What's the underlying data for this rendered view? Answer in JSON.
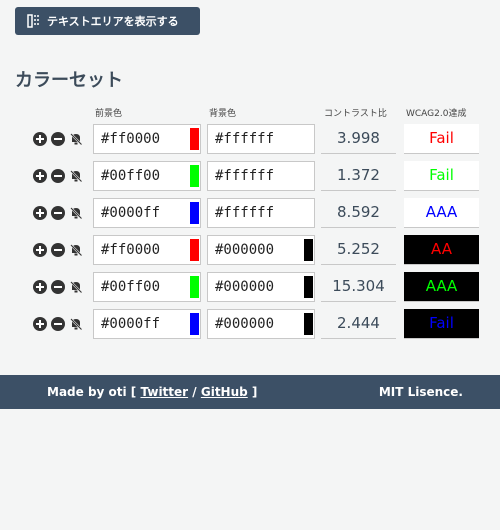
{
  "toolbar": {
    "toggle_label": "テキストエリアを表示する"
  },
  "section": {
    "title": "カラーセット"
  },
  "columns": {
    "foreground": "前景色",
    "background": "背景色",
    "contrast": "コントラスト比",
    "wcag": "WCAG2.0達成"
  },
  "rows": [
    {
      "fg": "#ff0000",
      "bg": "#ffffff",
      "ratio": "3.998",
      "grade": "Fail"
    },
    {
      "fg": "#00ff00",
      "bg": "#ffffff",
      "ratio": "1.372",
      "grade": "Fail"
    },
    {
      "fg": "#0000ff",
      "bg": "#ffffff",
      "ratio": "8.592",
      "grade": "AAA"
    },
    {
      "fg": "#ff0000",
      "bg": "#000000",
      "ratio": "5.252",
      "grade": "AA"
    },
    {
      "fg": "#00ff00",
      "bg": "#000000",
      "ratio": "15.304",
      "grade": "AAA"
    },
    {
      "fg": "#0000ff",
      "bg": "#000000",
      "ratio": "2.444",
      "grade": "Fail"
    }
  ],
  "footer": {
    "made_by": "Made by oti [",
    "twitter": "Twitter",
    "sep": "/",
    "github": "GitHub",
    "close": "]",
    "license": "MIT Lisence."
  },
  "colors": {
    "brand": "#3c5066",
    "text_dark": "#3c4b5a",
    "page_bg": "#f4f5f5"
  },
  "icons": [
    "textarea-icon",
    "add-row-icon",
    "remove-row-icon",
    "mute-icon"
  ]
}
